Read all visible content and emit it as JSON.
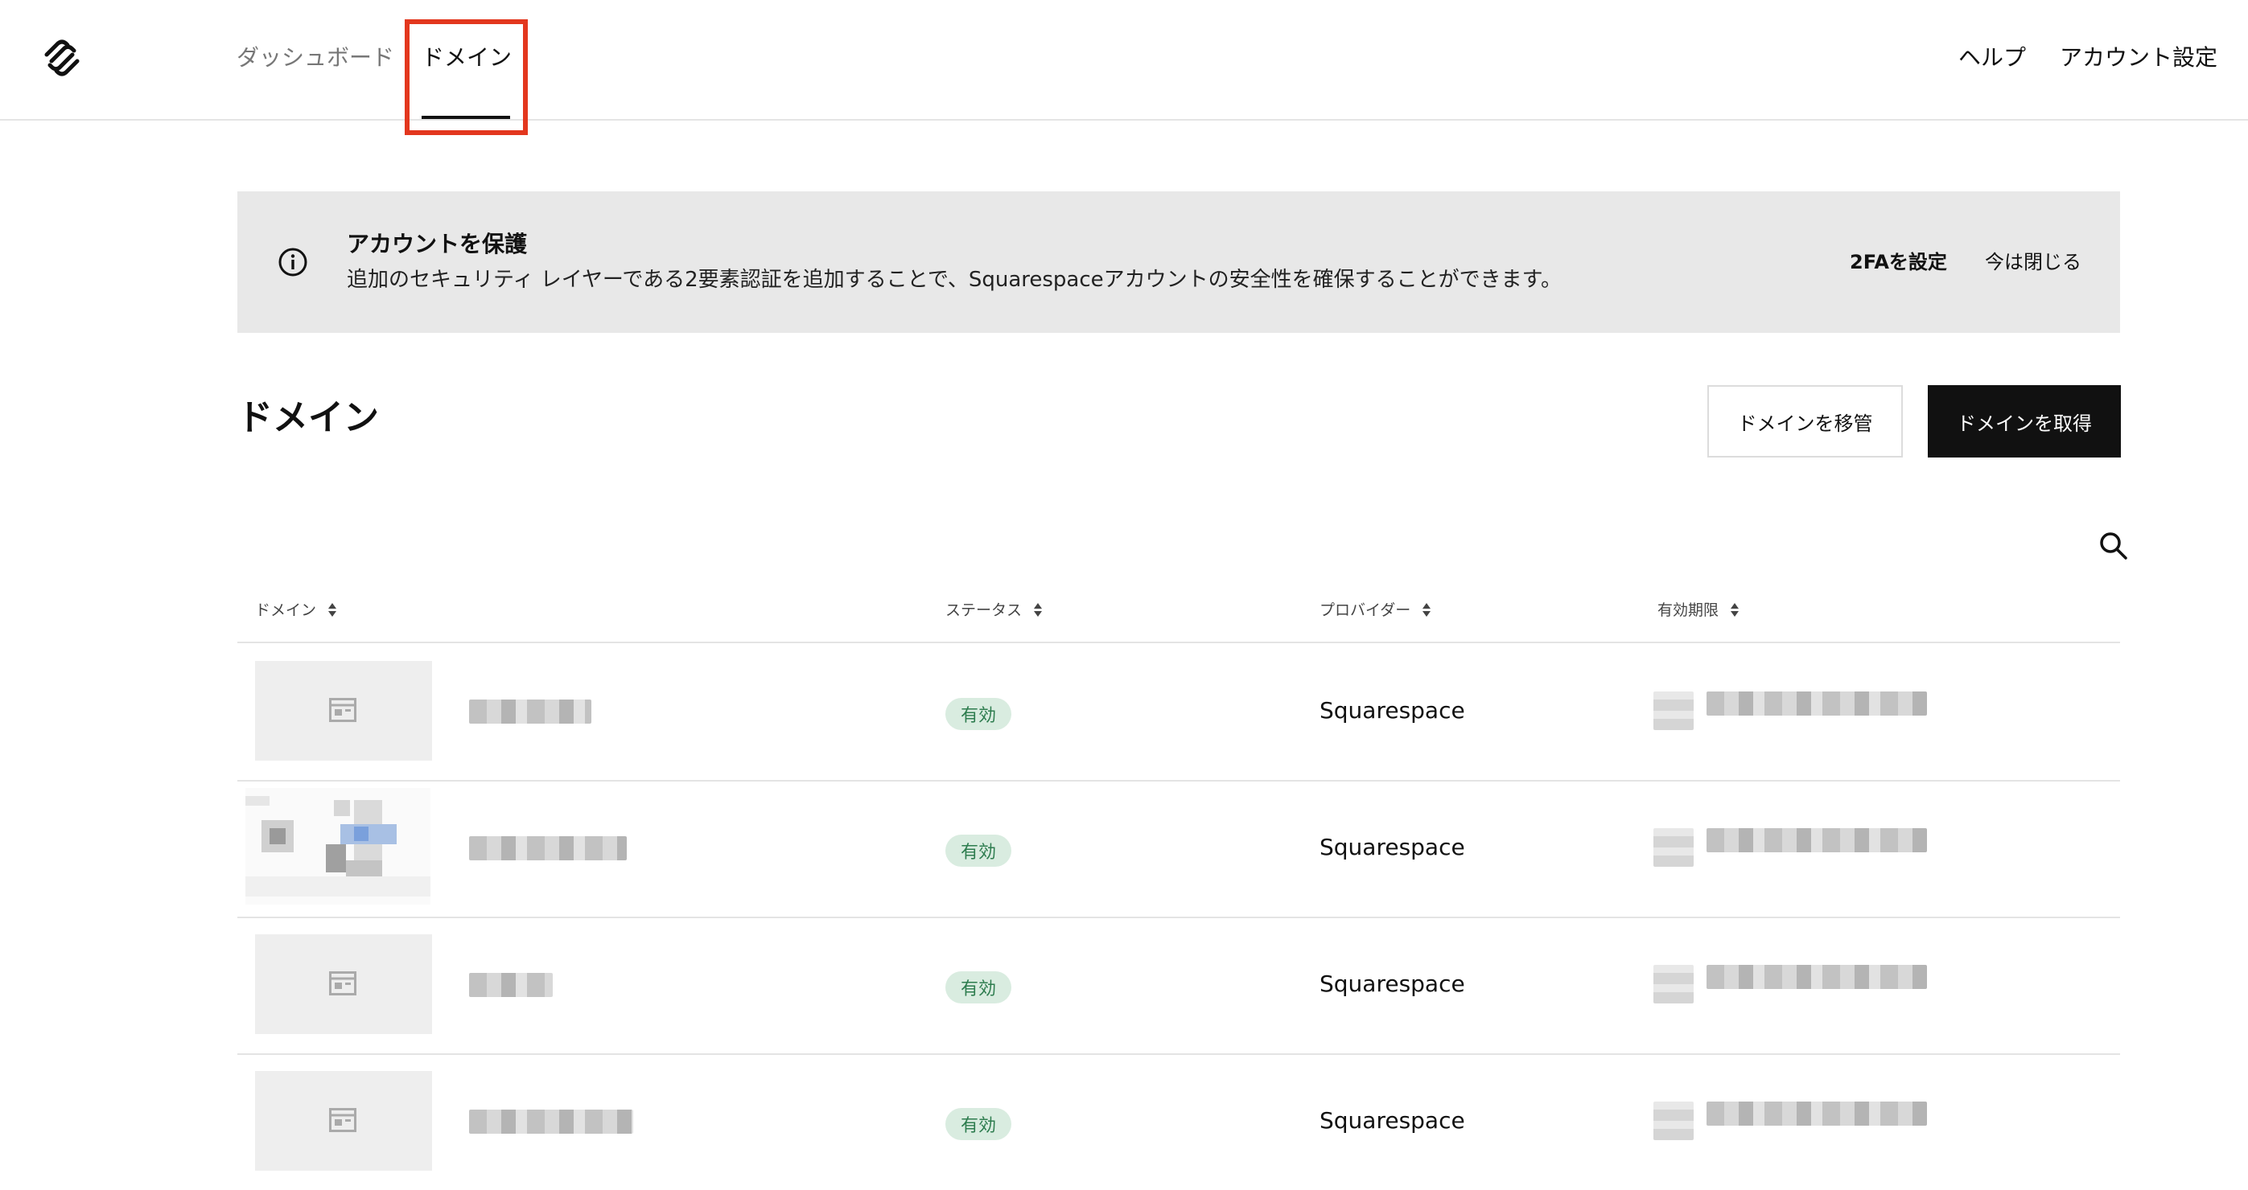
{
  "nav": {
    "dashboard": "ダッシュボード",
    "domains": "ドメイン",
    "help": "ヘルプ",
    "account_settings": "アカウント設定"
  },
  "banner": {
    "icon": "info-icon",
    "title": "アカウントを保護",
    "description": "追加のセキュリティ レイヤーである2要素認証を追加することで、Squarespaceアカウントの安全性を確保することができます。",
    "setup_2fa": "2FAを設定",
    "dismiss": "今は閉じる"
  },
  "page": {
    "title": "ドメイン",
    "transfer_button": "ドメインを移管",
    "get_button": "ドメインを取得"
  },
  "table": {
    "columns": [
      "ドメイン",
      "ステータス",
      "プロバイダー",
      "有効期限"
    ],
    "rows": [
      {
        "thumbnail": "placeholder",
        "domain": "[blurred]",
        "status": "有効",
        "provider": "Squarespace",
        "expiry": "[blurred]"
      },
      {
        "thumbnail": "site-preview",
        "domain": "[blurred]",
        "status": "有効",
        "provider": "Squarespace",
        "expiry": "[blurred]"
      },
      {
        "thumbnail": "placeholder",
        "domain": "[blurred]",
        "status": "有効",
        "provider": "Squarespace",
        "expiry": "[blurred]"
      },
      {
        "thumbnail": "placeholder",
        "domain": "[blurred]",
        "status": "有効",
        "provider": "Squarespace",
        "expiry": "[blurred]"
      }
    ]
  },
  "colors": {
    "highlight": "#e3371e",
    "primary_button": "#111111",
    "banner_bg": "#e8e8e8",
    "badge_bg": "#d9ece0",
    "badge_text": "#2e7d4f"
  }
}
